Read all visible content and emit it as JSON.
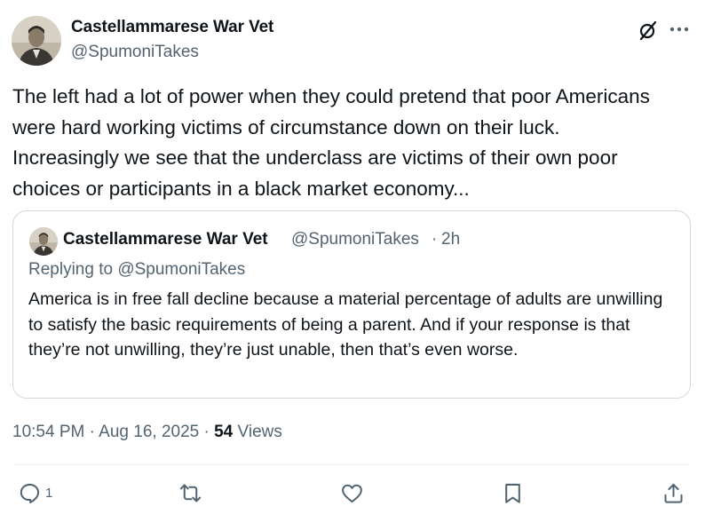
{
  "tweet": {
    "author": {
      "name": "Castellammarese War Vet",
      "handle": "@SpumoniTakes"
    },
    "text": "The left had a lot of power when they could pretend that poor Americans\nwere hard working victims of circumstance down on their luck.\nIncreasingly we see that  the underclass are victims of their own poor\nchoices or participants in a black market economy...",
    "time": "10:54 PM",
    "sep1": "·",
    "date": "Aug 16, 2025",
    "sep2": "·",
    "views": "54",
    "views_label": "Views"
  },
  "quote": {
    "author": {
      "name": "Castellammarese War Vet",
      "handle": "@SpumoniTakes"
    },
    "dot": "·",
    "time": "2h",
    "replying_to": "Replying to @SpumoniTakes",
    "text": "America is in free fall decline because a material percentage of adults are unwilling to satisfy the basic requirements of being a parent. And if your response is that they’re not unwilling, they’re just unable, then that’s even worse."
  },
  "actions": {
    "reply_count": "1",
    "icons": [
      "reply-icon",
      "retweet-icon",
      "like-icon",
      "bookmark-icon",
      "share-icon"
    ]
  },
  "header_icons": [
    "grok-icon",
    "more-icon"
  ],
  "colors": {
    "text": "#0f1419",
    "secondary": "#536471",
    "border": "#cfd9de"
  }
}
